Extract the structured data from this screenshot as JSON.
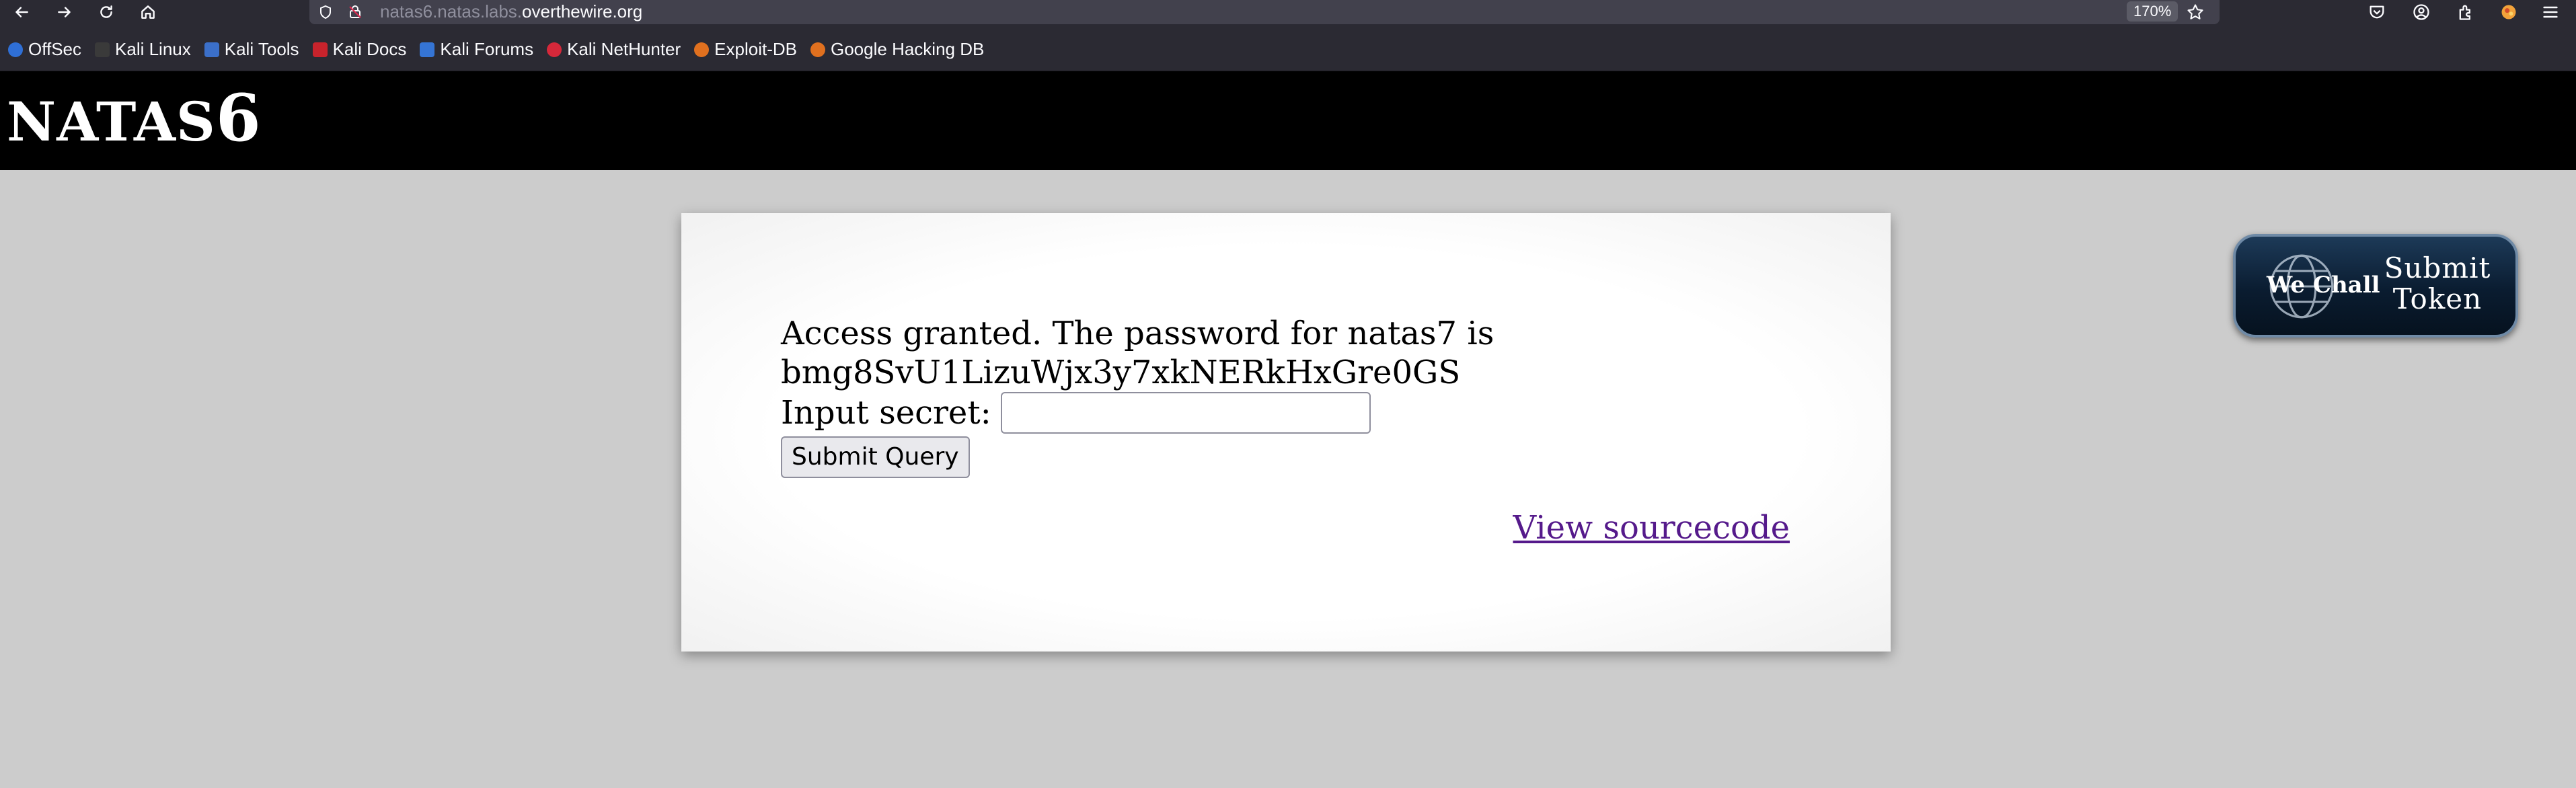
{
  "browser": {
    "url_prefix": "natas6.natas.labs.",
    "url_host": "overthewire.org",
    "zoom": "170%"
  },
  "bookmarks": [
    {
      "label": "OffSec",
      "color": "#2f6fd6"
    },
    {
      "label": "Kali Linux",
      "color": "#3a3a3a"
    },
    {
      "label": "Kali Tools",
      "color": "#3b6fc9"
    },
    {
      "label": "Kali Docs",
      "color": "#c8232c"
    },
    {
      "label": "Kali Forums",
      "color": "#3574d4"
    },
    {
      "label": "Kali NetHunter",
      "color": "#d6283a"
    },
    {
      "label": "Exploit-DB",
      "color": "#e0701f"
    },
    {
      "label": "Google Hacking DB",
      "color": "#e0701f"
    }
  ],
  "header": {
    "title_main": "NATAS",
    "title_num": "6"
  },
  "content": {
    "access_message": "Access granted. The password for natas7 is",
    "password": "bmg8SvU1LizuWjx3y7xkNERkHxGre0GS",
    "input_label": "Input secret:",
    "submit_label": "Submit Query",
    "source_link": "View sourcecode"
  },
  "wechall": {
    "brand": "We Chall",
    "line1": "Submit",
    "line2": "Token"
  },
  "icons": {
    "back": "back-arrow-icon",
    "forward": "forward-arrow-icon",
    "reload": "reload-icon",
    "home": "home-icon",
    "shield": "tracking-shield-icon",
    "lock": "lock-icon",
    "star": "bookmark-star-icon",
    "pocket": "pocket-icon",
    "account": "account-icon",
    "extensions": "extensions-icon",
    "profile": "profile-avatar-icon",
    "menu": "hamburger-menu-icon"
  },
  "colors": {
    "toolbar_bg": "#2b2a33",
    "urlbar_bg": "#42414d",
    "page_bg": "#cccccc",
    "header_bg": "#000000",
    "link_visited": "#551a8b"
  }
}
